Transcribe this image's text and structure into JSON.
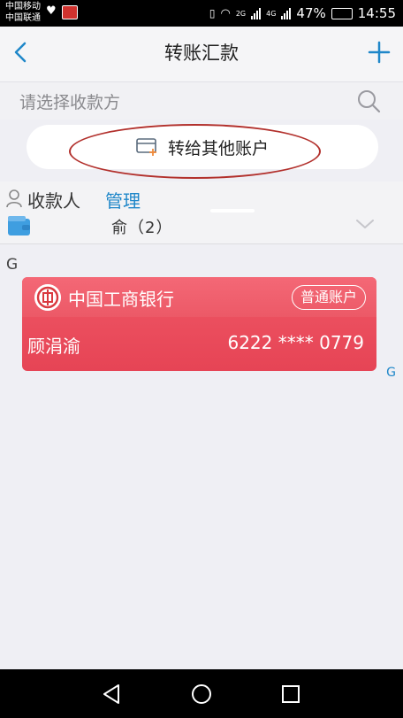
{
  "status_bar": {
    "carrier_1": "中国移动",
    "carrier_2": "中国联通",
    "network_1": "2G",
    "network_2": "4G",
    "battery": "47%",
    "time": "14:55"
  },
  "header": {
    "title": "转账汇款"
  },
  "search": {
    "placeholder": "请选择收款方"
  },
  "transfer_other": {
    "label": "转给其他账户"
  },
  "payees": {
    "label": "收款人",
    "manage_label": "管理",
    "group_label": "俞（2）"
  },
  "list": {
    "section_letter": "G",
    "index_letter": "G",
    "items": [
      {
        "bank_name": "中国工商银行",
        "account_type": "普通账户",
        "holder": "顾涓渝",
        "account_number": "6222 **** 0779"
      }
    ]
  },
  "colors": {
    "accent": "#1f87c9",
    "card": "#e64455",
    "annotation": "#b2302c"
  }
}
